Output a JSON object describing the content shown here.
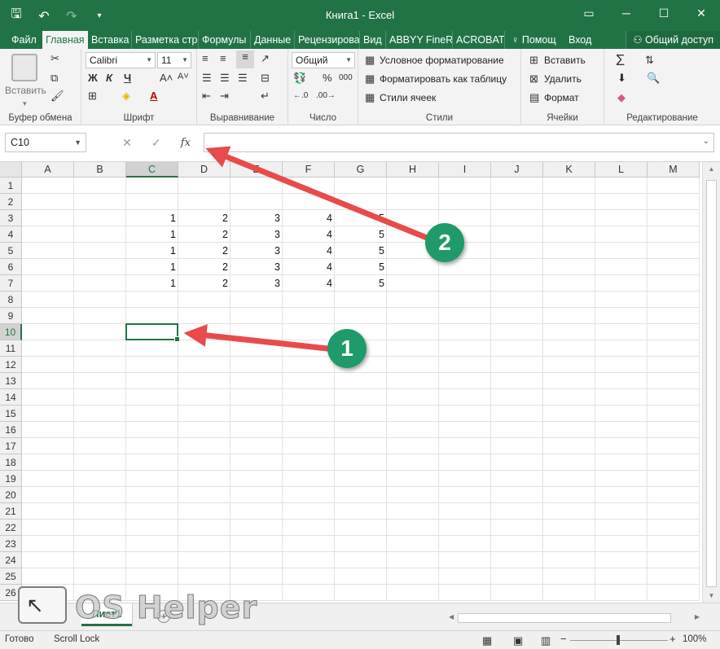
{
  "window": {
    "title": "Книга1 - Excel",
    "qat_icons": [
      "save-icon",
      "undo-icon",
      "redo-icon",
      "customize-icon"
    ],
    "controls": [
      "ribbon-display-icon",
      "minimize-icon",
      "restore-icon",
      "close-icon"
    ]
  },
  "tabs": [
    {
      "label": "Файл"
    },
    {
      "label": "Главная"
    },
    {
      "label": "Вставка"
    },
    {
      "label": "Разметка стр"
    },
    {
      "label": "Формулы"
    },
    {
      "label": "Данные"
    },
    {
      "label": "Рецензирова"
    },
    {
      "label": "Вид"
    },
    {
      "label": "ABBYY FineRe"
    },
    {
      "label": "ACROBAT"
    },
    {
      "label": "Помощ"
    },
    {
      "label": "Вход"
    }
  ],
  "share_label": "Общий доступ",
  "ribbon": {
    "clipboard": {
      "paste": "Вставить",
      "group": "Буфер обмена"
    },
    "font": {
      "name": "Calibri",
      "size": "11",
      "bold": "Ж",
      "italic": "К",
      "underline": "Ч",
      "group": "Шрифт"
    },
    "alignment": {
      "group": "Выравнивание"
    },
    "number": {
      "format": "Общий",
      "percent": "%",
      "thousands": "000",
      "group": "Число"
    },
    "styles": {
      "conditional": "Условное форматирование",
      "format_table": "Форматировать как таблицу",
      "cell_styles": "Стили ячеек",
      "group": "Стили"
    },
    "cells": {
      "insert": "Вставить",
      "delete": "Удалить",
      "format": "Формат",
      "group": "Ячейки"
    },
    "editing": {
      "group": "Редактирование"
    }
  },
  "formula_bar": {
    "name_box": "C10",
    "cancel": "✕",
    "enter": "✓",
    "fx": "fx",
    "value": ""
  },
  "sheet": {
    "columns": [
      "A",
      "B",
      "C",
      "D",
      "E",
      "F",
      "G",
      "H",
      "I",
      "J",
      "K",
      "L",
      "M"
    ],
    "rows": [
      "1",
      "2",
      "3",
      "4",
      "5",
      "6",
      "7",
      "8",
      "9",
      "10",
      "11",
      "12",
      "13",
      "14",
      "15",
      "16",
      "17",
      "18",
      "19",
      "20",
      "21",
      "22",
      "23",
      "24",
      "25",
      "26"
    ],
    "selected_column": "C",
    "selected_row": "10",
    "data_rows": [
      {
        "row": "3",
        "values": [
          "1",
          "2",
          "3",
          "4",
          "5"
        ]
      },
      {
        "row": "4",
        "values": [
          "1",
          "2",
          "3",
          "4",
          "5"
        ]
      },
      {
        "row": "5",
        "values": [
          "1",
          "2",
          "3",
          "4",
          "5"
        ]
      },
      {
        "row": "6",
        "values": [
          "1",
          "2",
          "3",
          "4",
          "5"
        ]
      },
      {
        "row": "7",
        "values": [
          "1",
          "2",
          "3",
          "4",
          "5"
        ]
      }
    ]
  },
  "sheet_tabs": [
    {
      "label": "Лист1"
    }
  ],
  "status": {
    "ready": "Готово",
    "scroll_lock": "Scroll Lock",
    "zoom": "100%"
  },
  "annotations": [
    {
      "label": "1",
      "color": "#1f9a6b"
    },
    {
      "label": "2",
      "color": "#1f9a6b"
    }
  ],
  "watermark": {
    "text": "OS Helper"
  },
  "colors": {
    "brand": "#217346",
    "arrow": "#e84b4b",
    "badge": "#1f9a6b"
  }
}
